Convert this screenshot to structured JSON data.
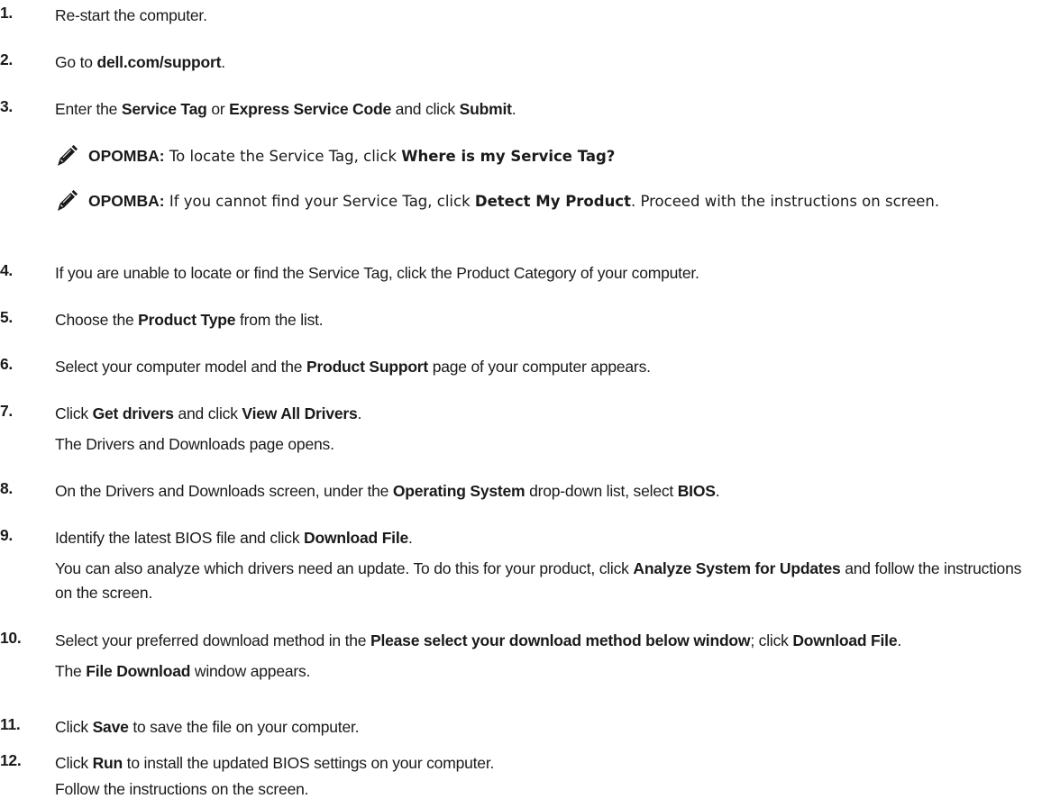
{
  "steps": [
    {
      "num": "1.",
      "parts": [
        {
          "t": "Re-start the computer."
        }
      ]
    },
    {
      "num": "2.",
      "parts": [
        {
          "t": "Go to "
        },
        {
          "t": "dell.com/support",
          "b": true
        },
        {
          "t": "."
        }
      ]
    },
    {
      "num": "3.",
      "parts": [
        {
          "t": "Enter the "
        },
        {
          "t": "Service Tag",
          "b": true
        },
        {
          "t": " or "
        },
        {
          "t": "Express Service Code",
          "b": true
        },
        {
          "t": " and click "
        },
        {
          "t": "Submit",
          "b": true
        },
        {
          "t": "."
        }
      ]
    },
    {
      "num": "4.",
      "parts": [
        {
          "t": "If you are unable to locate or find the Service Tag, click the Product Category of your computer."
        }
      ]
    },
    {
      "num": "5.",
      "parts": [
        {
          "t": "Choose the "
        },
        {
          "t": "Product Type",
          "b": true
        },
        {
          "t": " from the list."
        }
      ]
    },
    {
      "num": "6.",
      "parts": [
        {
          "t": "Select your computer model and the "
        },
        {
          "t": "Product Support",
          "b": true
        },
        {
          "t": " page of your computer appears."
        }
      ]
    },
    {
      "num": "7.",
      "parts": [
        {
          "t": "Click "
        },
        {
          "t": "Get drivers",
          "b": true
        },
        {
          "t": " and click "
        },
        {
          "t": "View All Drivers",
          "b": true
        },
        {
          "t": "."
        }
      ],
      "sub": [
        {
          "t": "The Drivers and Downloads page opens."
        }
      ]
    },
    {
      "num": "8.",
      "parts": [
        {
          "t": "On the Drivers and Downloads screen, under the "
        },
        {
          "t": "Operating System",
          "b": true
        },
        {
          "t": " drop-down list, select "
        },
        {
          "t": "BIOS",
          "b": true
        },
        {
          "t": "."
        }
      ]
    },
    {
      "num": "9.",
      "parts": [
        {
          "t": "Identify the latest BIOS file and click "
        },
        {
          "t": "Download File",
          "b": true
        },
        {
          "t": "."
        }
      ],
      "sub": [
        {
          "t": "You can also analyze which drivers need an update. To do this for your product, click "
        },
        {
          "t": "Analyze System for Updates",
          "b": true
        },
        {
          "t": " and follow the instructions on the screen."
        }
      ]
    },
    {
      "num": "10.",
      "parts": [
        {
          "t": "Select your preferred download method in the "
        },
        {
          "t": "Please select your download method below window",
          "b": true
        },
        {
          "t": "; click "
        },
        {
          "t": "Download File",
          "b": true
        },
        {
          "t": "."
        }
      ],
      "sub": [
        {
          "t": "The "
        },
        {
          "t": "File Download",
          "b": true
        },
        {
          "t": " window appears."
        }
      ]
    },
    {
      "num": "11.",
      "parts": [
        {
          "t": "Click "
        },
        {
          "t": "Save",
          "b": true
        },
        {
          "t": " to save the file on your computer."
        }
      ]
    },
    {
      "num": "12.",
      "parts": [
        {
          "t": "Click "
        },
        {
          "t": "Run",
          "b": true
        },
        {
          "t": " to install the updated BIOS settings on your computer."
        }
      ],
      "sub": [
        {
          "t": "Follow the instructions on the screen."
        }
      ]
    }
  ],
  "notes": [
    {
      "lead": "OPOMBA:",
      "parts": [
        {
          "t": " To locate the Service Tag, click "
        },
        {
          "t": "Where is my Service Tag?",
          "b": true
        }
      ]
    },
    {
      "lead": "OPOMBA:",
      "parts": [
        {
          "t": " If you cannot find your Service Tag, click "
        },
        {
          "t": "Detect My Product",
          "b": true
        },
        {
          "t": ". Proceed with the instructions on screen."
        }
      ]
    }
  ],
  "icons": {
    "note": "note-pencil-icon"
  }
}
